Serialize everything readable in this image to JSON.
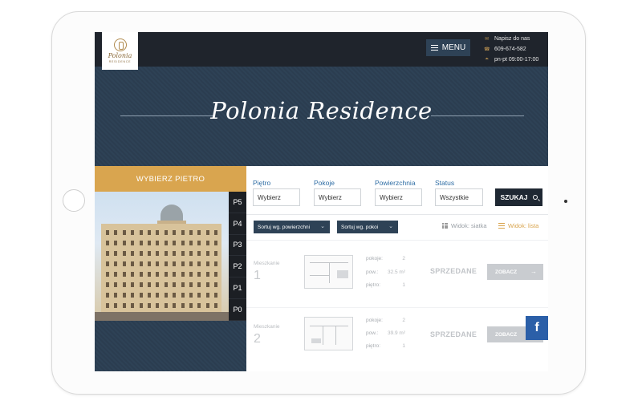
{
  "header": {
    "logo": {
      "script": "Polonia",
      "sub": "RESIDENCE"
    },
    "menu_label": "MENU",
    "contact": {
      "write": "Napisz do nas",
      "phone": "609-674-582",
      "hours": "pn-pt 09:00-17:00"
    }
  },
  "hero": {
    "title": "Polonia Residence"
  },
  "floor_selector": {
    "heading": "WYBIERZ PIETRO",
    "floors": [
      "P5",
      "P4",
      "P3",
      "P2",
      "P1",
      "P0"
    ]
  },
  "filters": {
    "floor": {
      "label": "Piętro",
      "value": "Wybierz"
    },
    "rooms": {
      "label": "Pokoje",
      "value": "Wybierz"
    },
    "area": {
      "label": "Powierzchnia",
      "value": "Wybierz"
    },
    "status": {
      "label": "Status",
      "value": "Wszystkie"
    },
    "search_label": "SZUKAJ"
  },
  "sorting": {
    "by_area": "Sortuj wg. powierzchni",
    "by_rooms": "Sortuj wg. pokoi",
    "view_grid": "Widok: siatka",
    "view_list": "Widok: lista"
  },
  "listings": [
    {
      "label": "Mieszkanie",
      "number": "1",
      "rooms_key": "pokoje:",
      "rooms": "2",
      "area_key": "pow.:",
      "area": "32.5 m²",
      "floor_key": "piętro:",
      "floor": "1",
      "status": "SPRZEDANE",
      "button": "ZOBACZ"
    },
    {
      "label": "Mieszkanie",
      "number": "2",
      "rooms_key": "pokoje:",
      "rooms": "2",
      "area_key": "pow.:",
      "area": "39.9 m²",
      "floor_key": "piętro:",
      "floor": "1",
      "status": "SPRZEDANE",
      "button": "ZOBACZ"
    }
  ],
  "social": {
    "facebook": "f"
  },
  "colors": {
    "gold": "#d9a54f",
    "navy": "#2e4256",
    "dark": "#1f242c",
    "link_blue": "#2e6da4"
  }
}
